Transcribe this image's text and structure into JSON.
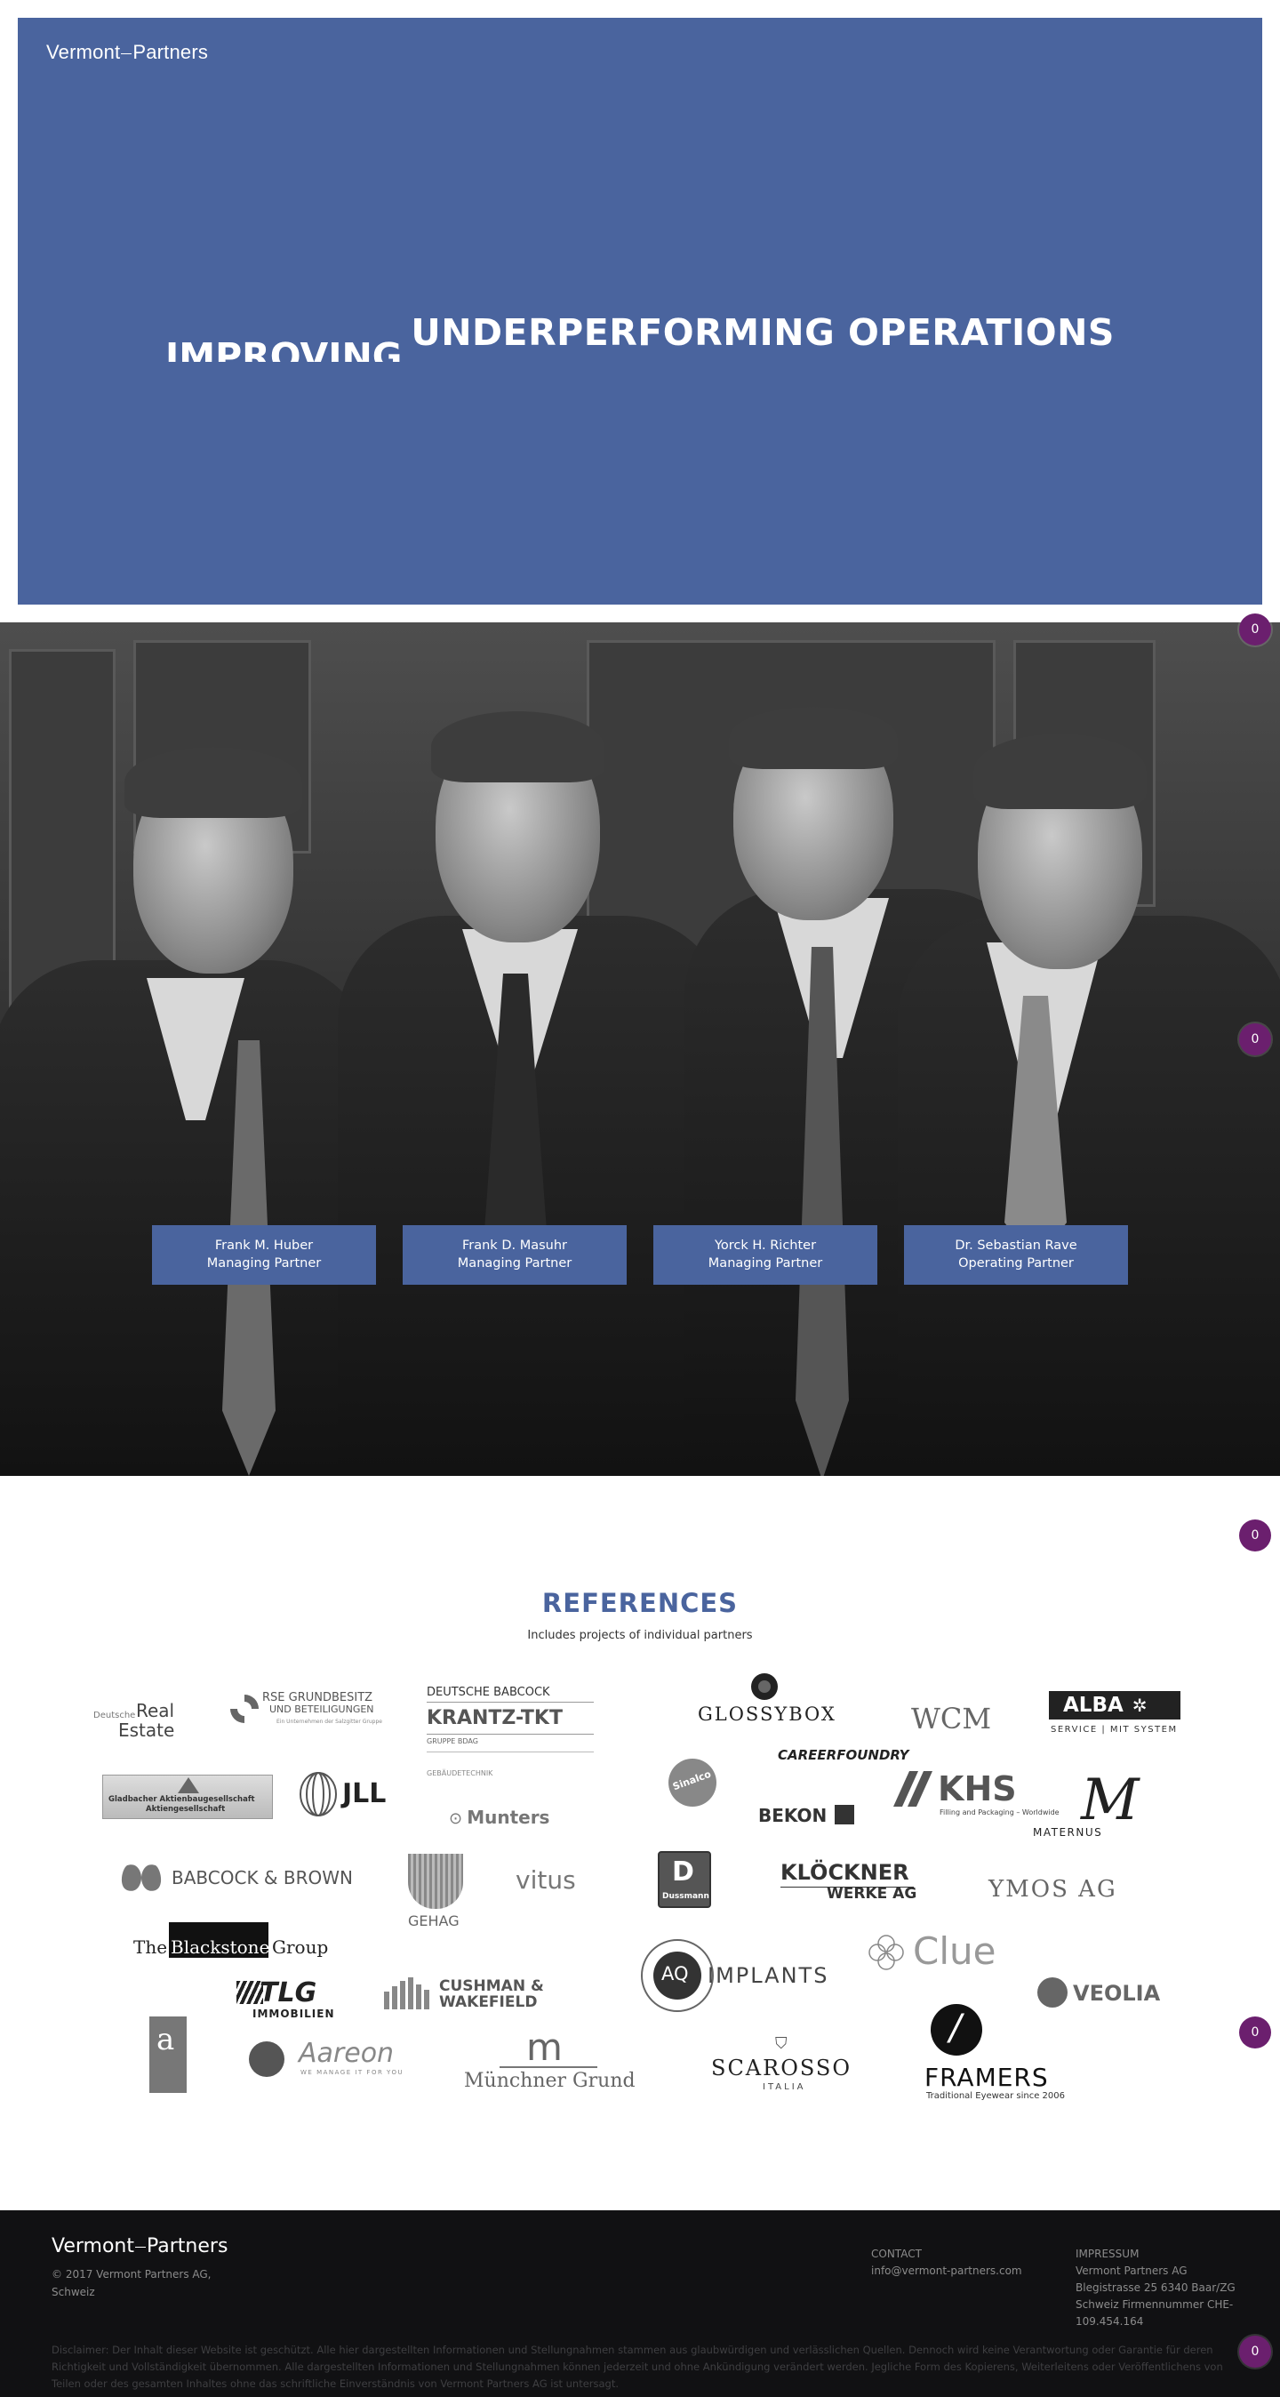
{
  "brand": {
    "logo_left": "Vermont",
    "logo_right": "Partners"
  },
  "hero": {
    "title_part1": "IMPROVING",
    "title_part2": "UNDERPERFORMING OPERATIONS"
  },
  "team": [
    {
      "name": "Frank M. Huber",
      "role": "Managing Partner"
    },
    {
      "name": "Frank D. Masuhr",
      "role": "Managing Partner"
    },
    {
      "name": "Yorck H. Richter",
      "role": "Managing Partner"
    },
    {
      "name": "Dr. Sebastian Rave",
      "role": "Operating Partner"
    }
  ],
  "references": {
    "title": "REFERENCES",
    "subtitle": "Includes projects of individual partners",
    "logos": {
      "real_estate_small": "Deutsche",
      "real_estate_big": "Real",
      "real_estate_big2": "Estate",
      "rse_line1": "RSE GRUNDBESITZ",
      "rse_line2": "UND BETEILIGUNGEN",
      "rse_line3": "Ein Unternehmen der Salzgitter Gruppe",
      "db_line1": "DEUTSCHE BABCOCK",
      "db_line2": "KRANTZ-TKT",
      "db_line3": "GRUPPE BDAG",
      "db_line4": "GEBÄUDETECHNIK",
      "glossybox": "GLOSSYBOX",
      "wcm": "WCM",
      "alba": "ALBA",
      "alba_sub": "SERVICE | MIT SYSTEM",
      "careerfoundry": "CAREERFOUNDRY",
      "gladbacher_line1": "Gladbacher Aktienbaugesellschaft",
      "gladbacher_line2": "Aktiengesellschaft",
      "jll": "JLL",
      "sinalco": "Sinalco",
      "khs": "KHS",
      "khs_sub": "Filling and Packaging – Worldwide",
      "maternus": "MATERNUS",
      "munters": "Munters",
      "bekon": "BEKON",
      "babcock_brown": "BABCOCK & BROWN",
      "gehag": "GEHAG",
      "vitus": "vitus",
      "dussmann": "Dussmann",
      "kloeckner_line1": "KLÖCKNER",
      "kloeckner_line2": "WERKE AG",
      "ymos": "YMOS AG",
      "blackstone_a": "The",
      "blackstone_b": "Blackstone",
      "blackstone_c": "Group",
      "aq": "AQ",
      "aq_implants": "IMPLANTS",
      "clue": "Clue",
      "tlg": "TLG",
      "tlg_sub": "IMMOBILIEN",
      "cushman_line1": "CUSHMAN &",
      "cushman_line2": "WAKEFIELD",
      "veolia": "VEOLIA",
      "aareon": "Aareon",
      "aareon_sub": "WE MANAGE IT FOR YOU",
      "muenchner": "Münchner Grund",
      "scarosso": "SCAROSSO",
      "scarosso_sub": "ITALIA",
      "framers": "FRAMERS",
      "framers_sub": "Traditional Eyewear since 2006"
    }
  },
  "footer": {
    "copyright_line1": "© 2017 Vermont Partners AG,",
    "copyright_line2": "Schweiz",
    "contact_heading": "CONTACT",
    "contact_email": "info@vermont-partners.com",
    "impressum_heading": "IMPRESSUM",
    "impressum_line1": "Vermont Partners AG",
    "impressum_line2": "Blegistrasse 25 6340 Baar/ZG",
    "impressum_line3": "Schweiz Firmennummer CHE-",
    "impressum_line4": "109.454.164",
    "disclaimer": "Disclaimer: Der Inhalt dieser Website ist geschützt. Alle hier dargestellten Informationen und Stellungnahmen stammen aus glaubwürdigen und verlässlichen Quellen. Dennoch wird keine Verantwortung oder Garantie für deren Richtigkeit und Vollständigkeit übernommen. Alle dargestellten Informationen und Stellungnahmen können jederzeit und ohne Ankündigung verändert werden. Jegliche Form des Kopierens, Weiterleitens oder Veröffentlichens von Teilen oder des gesamten Inhaltes ohne das schriftliche Einverständnis von Vermont Partners AG ist untersagt."
  },
  "badges": {
    "count": "0"
  },
  "colors": {
    "primary": "#4a649e",
    "badge": "#6b1f6e",
    "footer_bg": "#111113"
  }
}
